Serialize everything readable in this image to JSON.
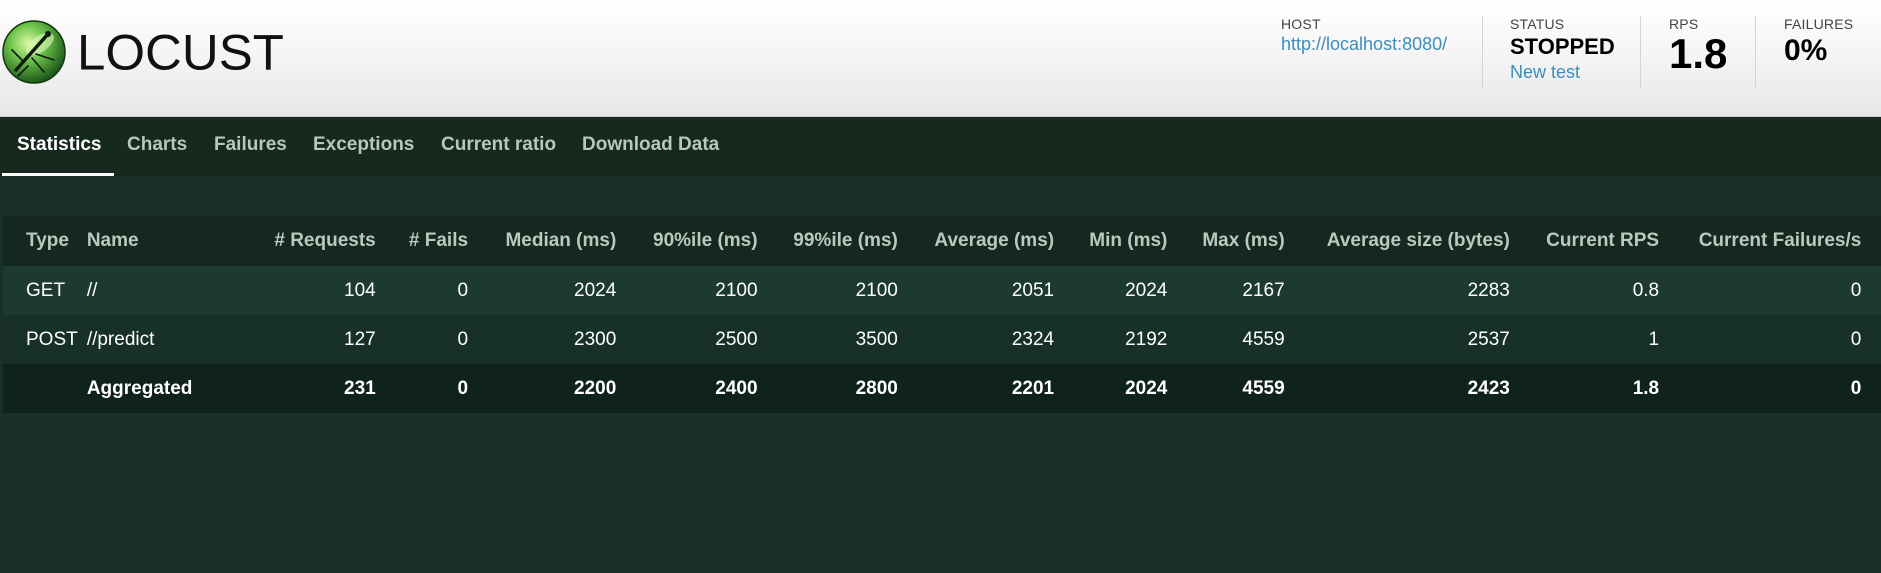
{
  "app": {
    "brand": "LOCUST"
  },
  "header": {
    "host_label": "HOST",
    "host_url": "http://localhost:8080/",
    "status_label": "STATUS",
    "status_value": "STOPPED",
    "new_test_label": "New test",
    "rps_label": "RPS",
    "rps_value": "1.8",
    "failures_label": "FAILURES",
    "failures_value": "0%"
  },
  "tabs": [
    {
      "label": "Statistics",
      "active": true
    },
    {
      "label": "Charts",
      "active": false
    },
    {
      "label": "Failures",
      "active": false
    },
    {
      "label": "Exceptions",
      "active": false
    },
    {
      "label": "Current ratio",
      "active": false
    },
    {
      "label": "Download Data",
      "active": false
    }
  ],
  "stats_table": {
    "columns": [
      "Type",
      "Name",
      "# Requests",
      "# Fails",
      "Median (ms)",
      "90%ile (ms)",
      "99%ile (ms)",
      "Average (ms)",
      "Min (ms)",
      "Max (ms)",
      "Average size (bytes)",
      "Current RPS",
      "Current Failures/s"
    ],
    "rows": [
      [
        "GET",
        "//",
        "104",
        "0",
        "2024",
        "2100",
        "2100",
        "2051",
        "2024",
        "2167",
        "2283",
        "0.8",
        "0"
      ],
      [
        "POST",
        "//predict",
        "127",
        "0",
        "2300",
        "2500",
        "3500",
        "2324",
        "2192",
        "4559",
        "2537",
        "1",
        "0"
      ]
    ],
    "total": [
      "",
      "Aggregated",
      "231",
      "0",
      "2200",
      "2400",
      "2800",
      "2201",
      "2024",
      "4559",
      "2423",
      "1.8",
      "0"
    ]
  },
  "colors": {
    "page_background": "#1a3129",
    "tab_bar": "#15291f",
    "link": "#3c8dbc",
    "table_header": "#142820",
    "row_odd": "#1c3a2f",
    "row_even": "#17302a",
    "row_total": "#10231b"
  }
}
